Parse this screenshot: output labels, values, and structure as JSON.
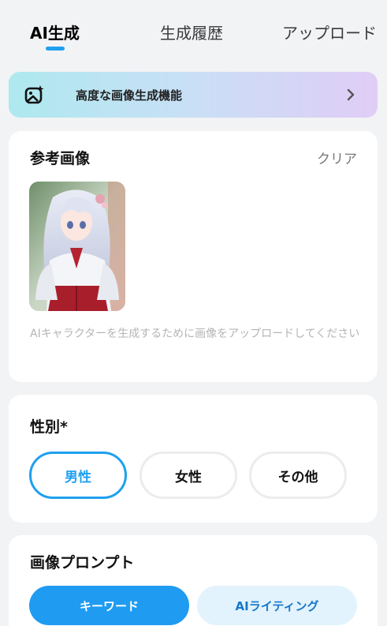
{
  "tabs": [
    {
      "label": "AI生成",
      "active": true
    },
    {
      "label": "生成履歴",
      "active": false
    },
    {
      "label": "アップロード",
      "active": false
    }
  ],
  "banner": {
    "label": "高度な画像生成機能",
    "icon": "image-sparkle-icon"
  },
  "reference": {
    "title": "参考画像",
    "clear_label": "クリア",
    "hint": "AIキャラクターを生成するために画像をアップロードしてください"
  },
  "gender": {
    "title": "性別*",
    "options": [
      "男性",
      "女性",
      "その他"
    ],
    "selected": "男性"
  },
  "prompt": {
    "title": "画像プロンプト",
    "modes": [
      "キーワード",
      "AIライティング"
    ],
    "selected": "キーワード"
  },
  "colors": {
    "accent": "#1ea0f0",
    "background": "#f2f3f5",
    "hint_text": "#b5b5b5"
  }
}
